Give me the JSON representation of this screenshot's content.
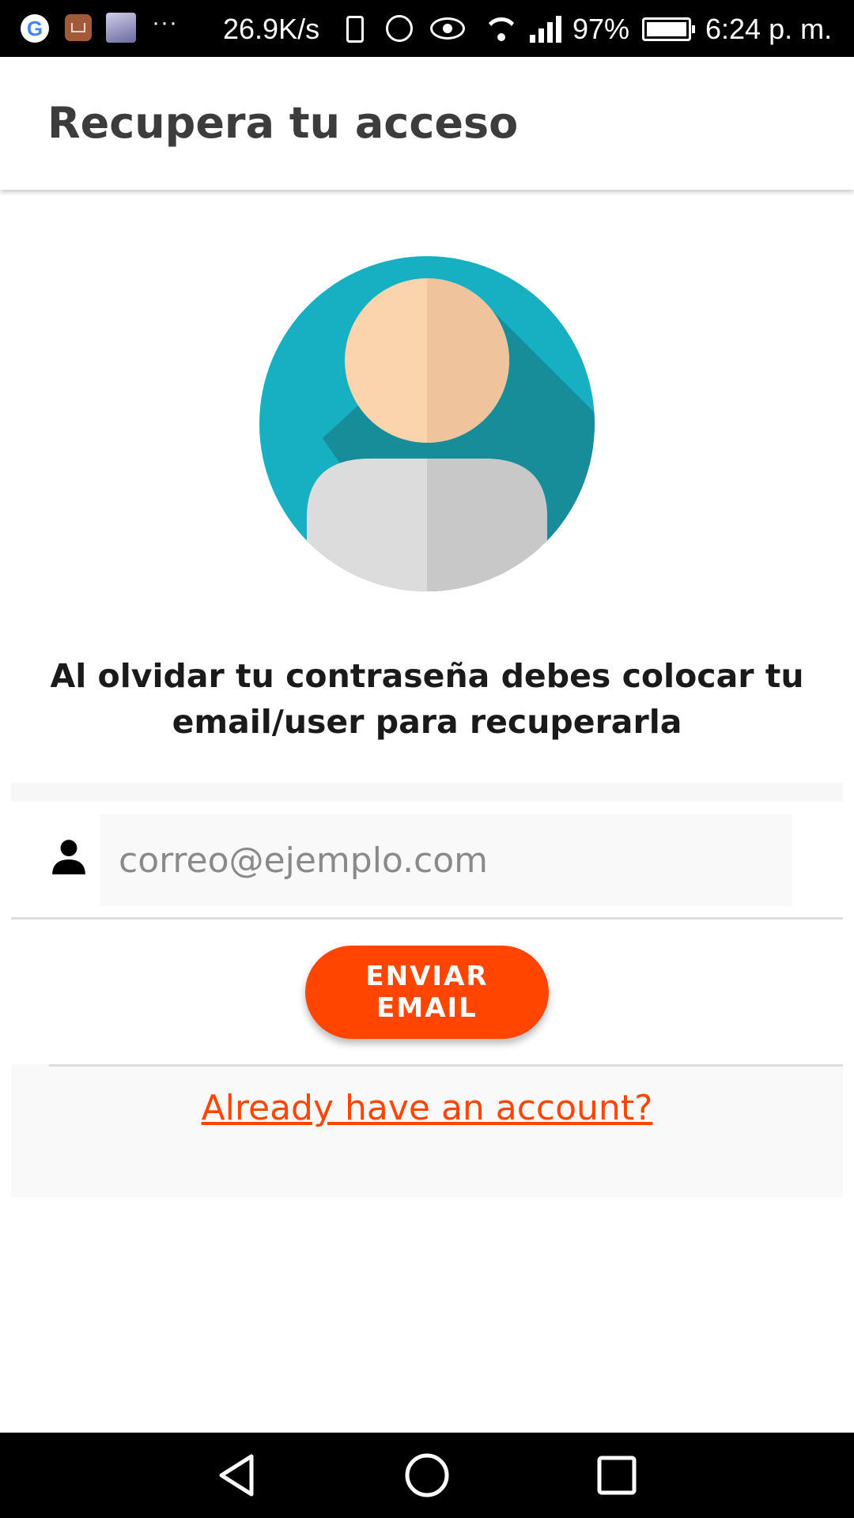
{
  "status_bar": {
    "google_icon_letter": "G",
    "more_indicator": "···",
    "network_speed": "26.9K/s",
    "battery_percent": "97%",
    "time": "6:24 p. m."
  },
  "app_bar": {
    "title": "Recupera tu acceso"
  },
  "instructions": {
    "text": "Al olvidar tu contraseña debes colocar tu email/user para recuperarla"
  },
  "form": {
    "email_placeholder": "correo@ejemplo.com",
    "email_value": "",
    "send_button_label": "ENVIAR EMAIL",
    "login_link_label": "Already have an account?"
  },
  "colors": {
    "accent": "#ff4500",
    "avatar_circle": "#17afc2",
    "avatar_circle_shadow": "#178d9a",
    "avatar_face": "#fbd3ad",
    "avatar_face_shade": "#efc49c",
    "avatar_body": "#dcdcdc",
    "avatar_body_shade": "#c8c8c8"
  },
  "icons": {
    "user_field_icon": "person-icon",
    "nav_back": "back-triangle-icon",
    "nav_home": "home-circle-icon",
    "nav_recents": "recents-square-icon"
  }
}
